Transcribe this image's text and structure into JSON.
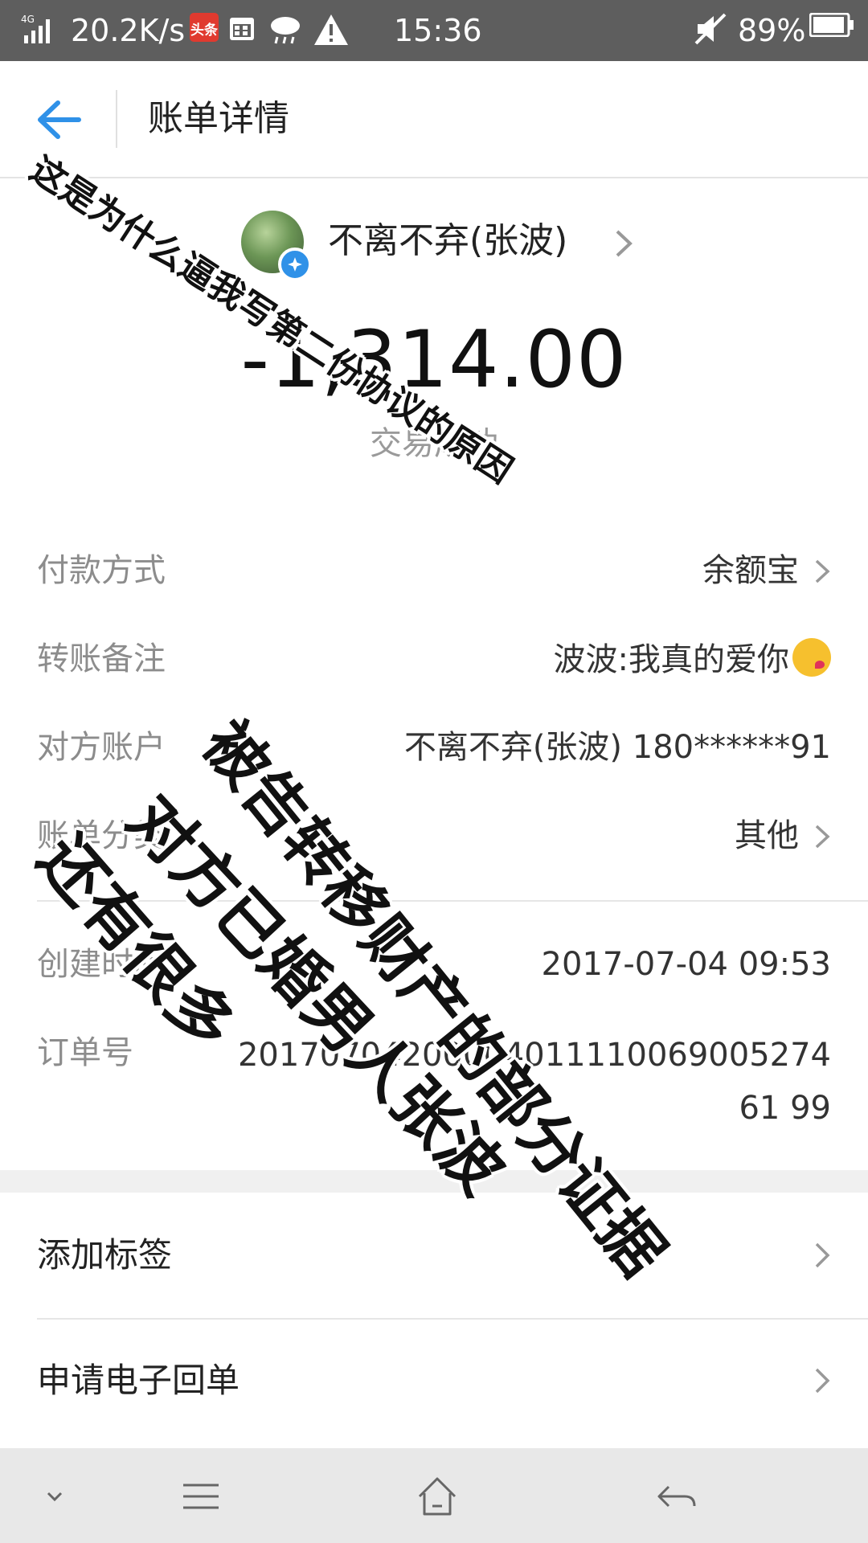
{
  "status_bar": {
    "network": "4G",
    "speed": "20.2K/s",
    "toutiao_badge": "头条",
    "time": "15:36",
    "battery": "89%"
  },
  "header": {
    "title": "账单详情"
  },
  "payee": {
    "name": "不离不弃(张波)"
  },
  "transaction": {
    "amount": "-1,314.00",
    "status": "交易成功"
  },
  "details": [
    {
      "label": "付款方式",
      "value": "余额宝"
    },
    {
      "label": "转账备注",
      "value": "波波:我真的爱你"
    },
    {
      "label": "对方账户",
      "value": "不离不弃(张波) 180******91"
    },
    {
      "label": "账单分类",
      "value": "其他"
    },
    {
      "label": "创建时间",
      "value": "2017-07-04 09:53"
    },
    {
      "label": "订单号",
      "value": "2017070420000401111006900527461 99"
    }
  ],
  "actions": [
    {
      "label": "添加标签"
    },
    {
      "label": "申请电子回单"
    }
  ],
  "annotations": [
    "这是为什么逼我写第二份协议的原因",
    "被告转移财产的部分证据",
    "对方已婚男人张波",
    "还有很多"
  ],
  "colors": {
    "accent": "#2f91e8",
    "status_bar": "#5e5e5e",
    "label_gray": "#8c8c8c",
    "nav_bar": "#e8e8e8"
  }
}
